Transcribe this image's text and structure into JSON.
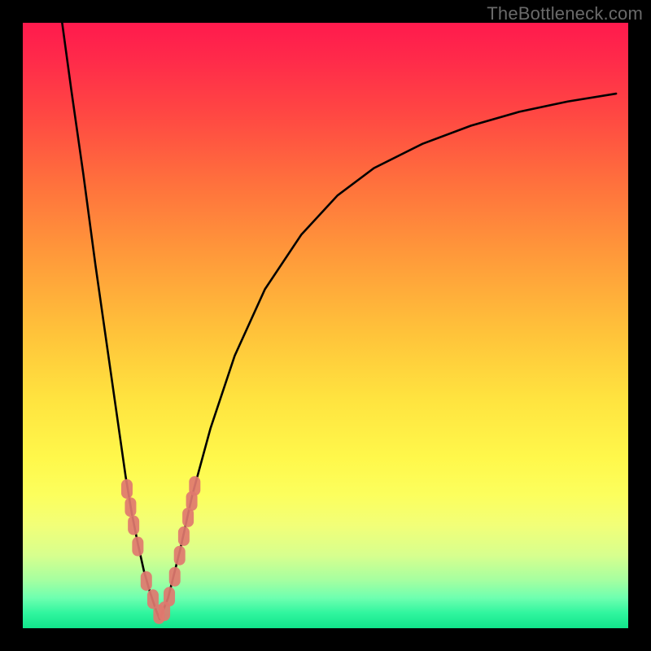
{
  "watermark": "TheBottleneck.com",
  "colors": {
    "frame": "#000000",
    "curve": "#000000",
    "marker_fill": "#e0786f",
    "marker_stroke": "#c45a52",
    "gradient_top": "#ff1a4d",
    "gradient_bottom": "#11e58b"
  },
  "chart_data": {
    "type": "line",
    "title": "",
    "xlabel": "",
    "ylabel": "",
    "xlim": [
      0,
      100
    ],
    "ylim": [
      0,
      100
    ],
    "grid": false,
    "legend": false,
    "note": "Abstract bottleneck curve; no axes or tick labels rendered. Values are percentage estimates read from pixel positions (0,0 at bottom-left of colored plot area).",
    "series": [
      {
        "name": "left-branch",
        "x": [
          6.5,
          8,
          10,
          12,
          14,
          16,
          17,
          18,
          19,
          20,
          21,
          22,
          22.6
        ],
        "y": [
          100,
          89,
          75,
          60,
          46,
          32,
          25,
          19,
          14,
          9.5,
          6,
          3,
          1.5
        ]
      },
      {
        "name": "right-branch",
        "x": [
          22.6,
          24,
          26,
          28,
          31,
          35,
          40,
          46,
          52,
          58,
          66,
          74,
          82,
          90,
          98
        ],
        "y": [
          1.5,
          5,
          13,
          22,
          33,
          45,
          56,
          65,
          71.5,
          76,
          80,
          83,
          85.3,
          87,
          88.3
        ]
      }
    ],
    "markers": {
      "name": "highlighted-points",
      "shape": "rounded-capsule",
      "x": [
        17.2,
        17.8,
        18.3,
        19.0,
        20.4,
        21.5,
        22.5,
        23.4,
        24.2,
        25.1,
        25.9,
        26.6,
        27.3,
        27.9,
        28.4
      ],
      "y": [
        23,
        20,
        17,
        13.5,
        7.8,
        4.8,
        2.3,
        2.8,
        5.2,
        8.5,
        12,
        15.2,
        18.3,
        21,
        23.5
      ]
    }
  }
}
